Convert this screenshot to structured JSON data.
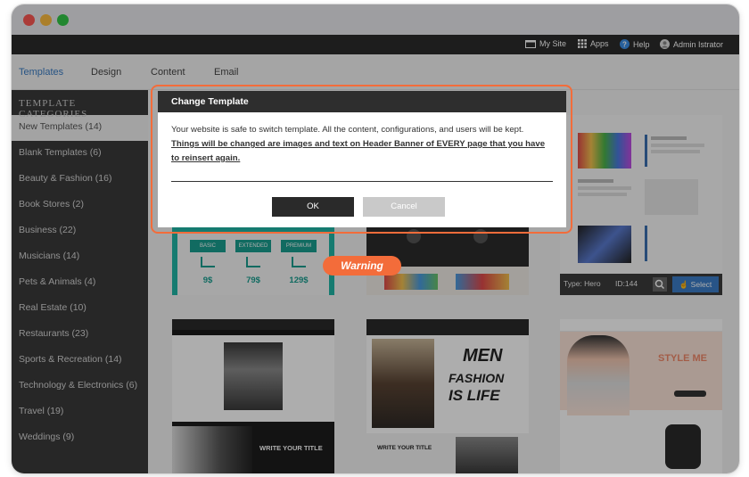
{
  "topnav": {
    "my_site": "My Site",
    "apps": "Apps",
    "help": "Help",
    "user": "Admin Istrator"
  },
  "tabs": [
    "Templates",
    "Design",
    "Content",
    "Email"
  ],
  "sidebar": {
    "heading": "TEMPLATE CATEGORIES",
    "items": [
      "New Templates (14)",
      "Blank Templates (6)",
      "Beauty & Fashion (16)",
      "Book Stores (2)",
      "Business (22)",
      "Musicians (14)",
      "Pets & Animals (4)",
      "Real Estate (10)",
      "Restaurants (23)",
      "Sports & Recreation (14)",
      "Technology & Electronics (6)",
      "Travel (19)",
      "Weddings (9)"
    ]
  },
  "thumbs": {
    "pricing": {
      "basic": "BASIC",
      "extended": "EXTENDED",
      "premium": "PREMIUM",
      "p1": "9$",
      "p2": "79$",
      "p3": "129$"
    },
    "hero_info": {
      "type": "Type: Hero",
      "id": "ID:144",
      "select": "Select"
    },
    "t4": {
      "write": "WRITE YOUR TITLE"
    },
    "t5": {
      "men1": "MEN",
      "men2": "FASHION",
      "men3": "IS LIFE",
      "write": "WRITE YOUR TITLE"
    },
    "t6": {
      "style": "STYLE ME"
    }
  },
  "modal": {
    "title": "Change Template",
    "body_plain": "Your website is safe to switch template. All the content, configurations, and users will be kept.",
    "body_bold": "Things will be changed are images and text on Header Banner of EVERY page that you have to reinsert again.",
    "ok": "OK",
    "cancel": "Cancel"
  },
  "callout": "Warning",
  "colors": {
    "accent": "#f36c3a",
    "tab_active": "#3a7cc3",
    "sidebar": "#3a3a3a"
  }
}
